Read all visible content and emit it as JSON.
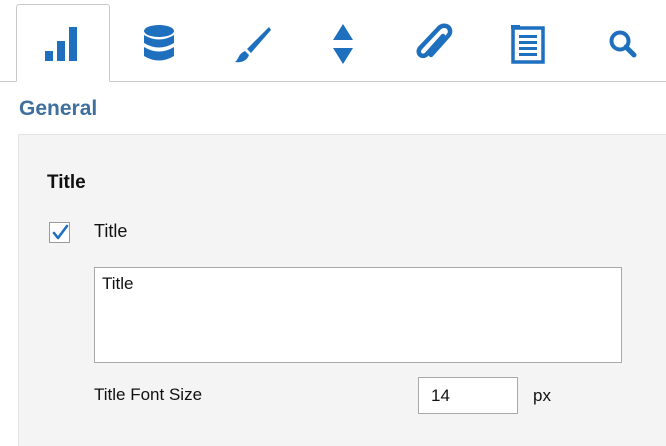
{
  "tabs": [
    {
      "id": "chart",
      "icon": "bar-chart-icon",
      "active": true
    },
    {
      "id": "data",
      "icon": "database-icon",
      "active": false
    },
    {
      "id": "design",
      "icon": "paintbrush-icon",
      "active": false
    },
    {
      "id": "sort",
      "icon": "sort-arrows-icon",
      "active": false
    },
    {
      "id": "attachments",
      "icon": "paperclip-icon",
      "active": false
    },
    {
      "id": "legend",
      "icon": "list-icon",
      "active": false
    },
    {
      "id": "search",
      "icon": "search-icon",
      "active": false
    }
  ],
  "colors": {
    "accent": "#1f6fbf",
    "section_label": "#3f6f9f",
    "panel_bg": "#f4f4f4"
  },
  "section": {
    "label": "General"
  },
  "group": {
    "title": "Title"
  },
  "title_checkbox": {
    "label": "Title",
    "checked": true
  },
  "title_text": {
    "value": "Title"
  },
  "font_size": {
    "label": "Title Font Size",
    "value": "14",
    "unit": "px"
  }
}
